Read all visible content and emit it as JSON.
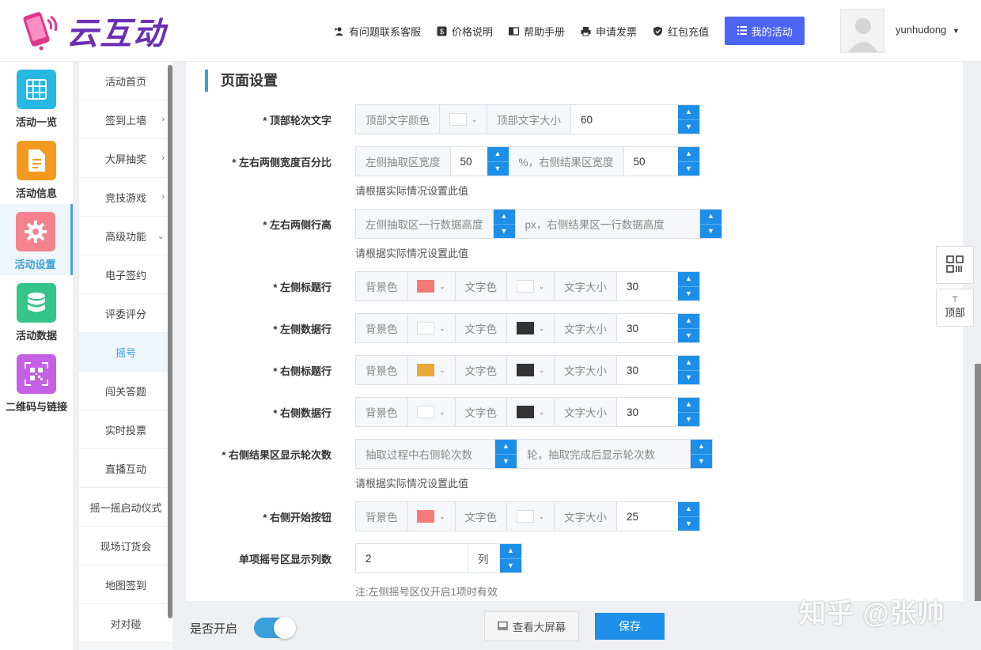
{
  "brand": {
    "name": "云互动"
  },
  "header": {
    "nav": [
      {
        "label": "有问题联系客服",
        "icon": "add-user-icon"
      },
      {
        "label": "价格说明",
        "icon": "dollar-icon"
      },
      {
        "label": "帮助手册",
        "icon": "book-icon"
      },
      {
        "label": "申请发票",
        "icon": "printer-icon"
      },
      {
        "label": "红包充值",
        "icon": "shield-icon"
      }
    ],
    "my_activity_label": "我的活动",
    "username": "yunhudong"
  },
  "iconbar": [
    {
      "label": "活动一览",
      "icon": "grid-icon",
      "color": "#27b7e3"
    },
    {
      "label": "活动信息",
      "icon": "document-icon",
      "color": "#f39a1e"
    },
    {
      "label": "活动设置",
      "icon": "gear-icon",
      "color": "#f5838e",
      "active": true
    },
    {
      "label": "活动数据",
      "icon": "database-icon",
      "color": "#35c48a"
    },
    {
      "label": "二维码与链接",
      "icon": "qrcode-icon",
      "color": "#c45fe6"
    }
  ],
  "submenu": [
    {
      "label": "活动首页"
    },
    {
      "label": "签到上墙",
      "arrow": "›"
    },
    {
      "label": "大屏抽奖",
      "arrow": "›"
    },
    {
      "label": "竞技游戏",
      "arrow": "›"
    },
    {
      "label": "高级功能",
      "arrow": "⌄"
    },
    {
      "label": "电子签约"
    },
    {
      "label": "评委评分"
    },
    {
      "label": "摇号",
      "active": true
    },
    {
      "label": "闯关答题"
    },
    {
      "label": "实时投票"
    },
    {
      "label": "直播互动"
    },
    {
      "label": "摇一摇启动仪式"
    },
    {
      "label": "现场订货会"
    },
    {
      "label": "地图签到"
    },
    {
      "label": "对对碰"
    }
  ],
  "section_title": "页面设置",
  "form": {
    "top_text": {
      "label": "* 顶部轮次文字",
      "color_addon": "顶部文字颜色",
      "color": "#ffffff",
      "size_addon": "顶部文字大小",
      "size": "60"
    },
    "width_pct": {
      "label": "* 左右两侧宽度百分比",
      "left_addon": "左侧抽取区宽度",
      "left_value": "50",
      "right_addon": "%，右侧结果区宽度",
      "right_value": "50",
      "hint": "请根据实际情况设置此值"
    },
    "row_height": {
      "label": "* 左右两侧行高",
      "left_addon": "左侧抽取区一行数据高度",
      "right_addon": "px，右侧结果区一行数据高度",
      "hint": "请根据实际情况设置此值"
    },
    "left_title_row": {
      "label": "* 左侧标题行",
      "bg_label": "背景色",
      "bg_color": "#f47b78",
      "text_label": "文字色",
      "text_color": "#ffffff",
      "size_label": "文字大小",
      "size": "30"
    },
    "left_data_row": {
      "label": "* 左侧数据行",
      "bg_label": "背景色",
      "bg_color": "#ffffff",
      "text_label": "文字色",
      "text_color": "#333333",
      "size_label": "文字大小",
      "size": "30"
    },
    "right_title_row": {
      "label": "* 右侧标题行",
      "bg_label": "背景色",
      "bg_color": "#e9a93a",
      "text_label": "文字色",
      "text_color": "#333333",
      "size_label": "文字大小",
      "size": "30"
    },
    "right_data_row": {
      "label": "* 右侧数据行",
      "bg_label": "背景色",
      "bg_color": "#ffffff",
      "text_label": "文字色",
      "text_color": "#333333",
      "size_label": "文字大小",
      "size": "30"
    },
    "rounds": {
      "label": "* 右侧结果区显示轮次数",
      "left_addon": "抽取过程中右侧轮次数",
      "right_addon": "轮，抽取完成后显示轮次数",
      "hint": "请根据实际情况设置此值"
    },
    "start_button": {
      "label": "* 右侧开始按钮",
      "bg_label": "背景色",
      "bg_color": "#f47b78",
      "text_label": "文字色",
      "text_color": "#ffffff",
      "size_label": "文字大小",
      "size": "25"
    },
    "columns": {
      "label": "单项摇号区显示列数",
      "value": "2",
      "unit": "列",
      "hint": "注:左侧摇号区仅开启1项时有效"
    }
  },
  "float_tools": {
    "qr_icon": "qrcode-icon",
    "top_label": "顶部"
  },
  "footer": {
    "toggle_label": "是否开启",
    "toggle_on": true,
    "view_button": "查看大屏幕",
    "save_button": "保存"
  },
  "watermark": "知乎 @张帅"
}
